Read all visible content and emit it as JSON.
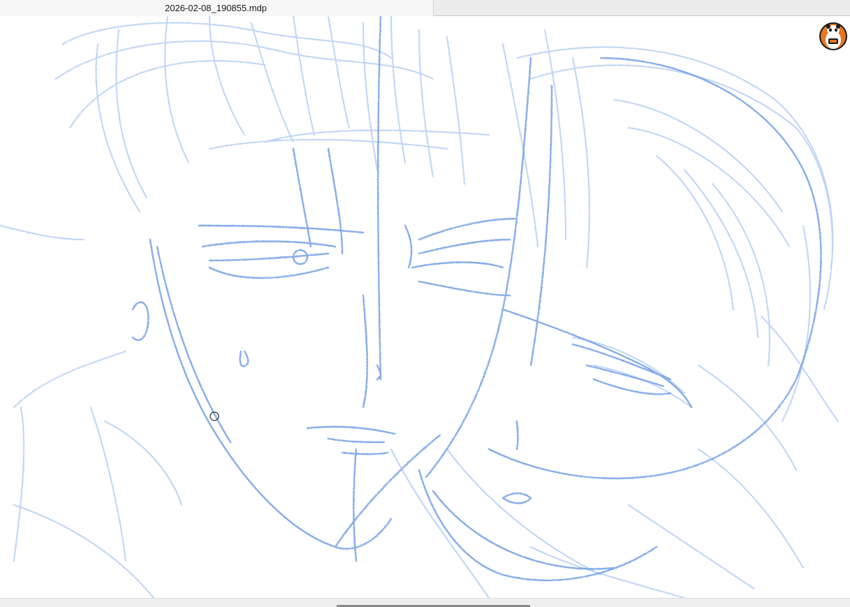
{
  "document": {
    "tab_title": "2026-02-08_190855.mdp"
  },
  "colors": {
    "sketch_stroke": "#6f9ee6",
    "sketch_light": "#a9c6f2",
    "canvas_bg": "#ffffff",
    "tabbar_bg": "#ececec",
    "active_tab_bg": "#f7f7f7",
    "scroll_thumb": "#8b8b8b"
  },
  "icons": {
    "account": "panda-mascot-icon",
    "cursor": "brush-cursor-icon"
  }
}
